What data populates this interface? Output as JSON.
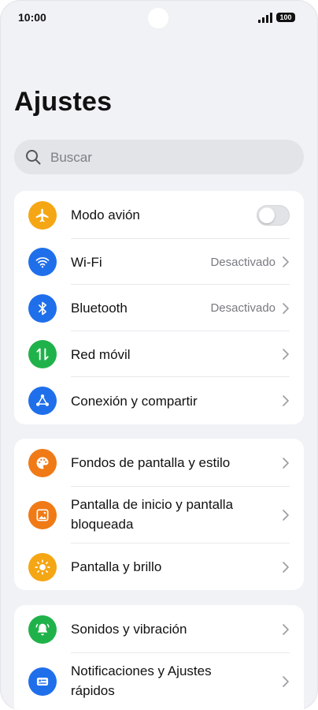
{
  "status_bar": {
    "time": "10:00",
    "battery": "100"
  },
  "page": {
    "title": "Ajustes"
  },
  "search": {
    "placeholder": "Buscar"
  },
  "colors": {
    "airplane": "#f5a614",
    "wifi": "#1f6feb",
    "bluetooth": "#1f6feb",
    "mobile": "#20b24a",
    "connection": "#1f6feb",
    "wallpaper": "#f07a16",
    "home": "#f07a16",
    "display": "#f5a614",
    "sound": "#20b24a",
    "notifications": "#1f6feb"
  },
  "cards": [
    {
      "items": [
        {
          "label": "Modo avión",
          "icon": "airplane-icon",
          "control": "toggle",
          "toggle_on": false
        },
        {
          "label": "Wi-Fi",
          "icon": "wifi-icon",
          "value": "Desactivado"
        },
        {
          "label": "Bluetooth",
          "icon": "bluetooth-icon",
          "value": "Desactivado"
        },
        {
          "label": "Red móvil",
          "icon": "mobile-data-icon"
        },
        {
          "label": "Conexión y compartir",
          "icon": "share-connection-icon"
        }
      ]
    },
    {
      "items": [
        {
          "label": "Fondos de pantalla y estilo",
          "icon": "palette-icon"
        },
        {
          "label_line1": "Pantalla de inicio y pantalla",
          "label_line2": "bloqueada",
          "icon": "home-lock-screen-icon"
        },
        {
          "label": "Pantalla y brillo",
          "icon": "brightness-icon"
        }
      ]
    },
    {
      "items": [
        {
          "label": "Sonidos y vibración",
          "icon": "bell-icon"
        },
        {
          "label_line1": "Notificaciones y Ajustes",
          "label_line2": "rápidos",
          "icon": "notification-card-icon"
        }
      ]
    }
  ]
}
